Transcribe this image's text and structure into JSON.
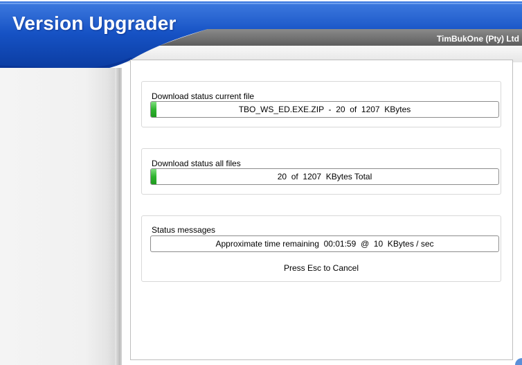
{
  "window": {
    "title": "Version Upgrader",
    "company": "TimBukOne (Pty) Ltd"
  },
  "colors": {
    "header_blue": "#0b3fa8",
    "header_grey": "#6f6f6f",
    "progress_green": "#2fb42f"
  },
  "current_file": {
    "label": "Download status current file",
    "progress_text": "TBO_WS_ED.EXE.ZIP  -  20  of  1207  KBytes",
    "progress_fraction": 0.0166
  },
  "all_files": {
    "label": "Download status all files",
    "progress_text": "20  of  1207  KBytes Total",
    "progress_fraction": 0.0166
  },
  "status": {
    "label": "Status messages",
    "message": "Approximate time remaining  00:01:59  @  10  KBytes / sec",
    "hint": "Press Esc to Cancel"
  }
}
